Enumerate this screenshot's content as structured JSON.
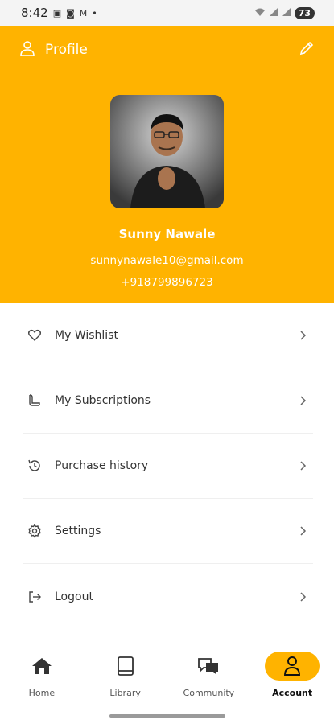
{
  "status_bar": {
    "time": "8:42",
    "battery": "73"
  },
  "header": {
    "title": "Profile",
    "name": "Sunny Nawale",
    "email": "sunnynawale10@gmail.com",
    "phone": "+918799896723",
    "accent_color": "#ffb300"
  },
  "menu": {
    "items": [
      {
        "label": "My Wishlist",
        "icon": "heart-icon"
      },
      {
        "label": "My Subscriptions",
        "icon": "subscriptions-icon"
      },
      {
        "label": "Purchase history",
        "icon": "history-icon"
      },
      {
        "label": "Settings",
        "icon": "gear-icon"
      },
      {
        "label": "Logout",
        "icon": "logout-icon"
      }
    ]
  },
  "bottom_nav": {
    "items": [
      {
        "label": "Home",
        "icon": "home-icon"
      },
      {
        "label": "Library",
        "icon": "book-icon"
      },
      {
        "label": "Community",
        "icon": "chat-icon"
      },
      {
        "label": "Account",
        "icon": "person-icon",
        "active": true
      }
    ]
  }
}
